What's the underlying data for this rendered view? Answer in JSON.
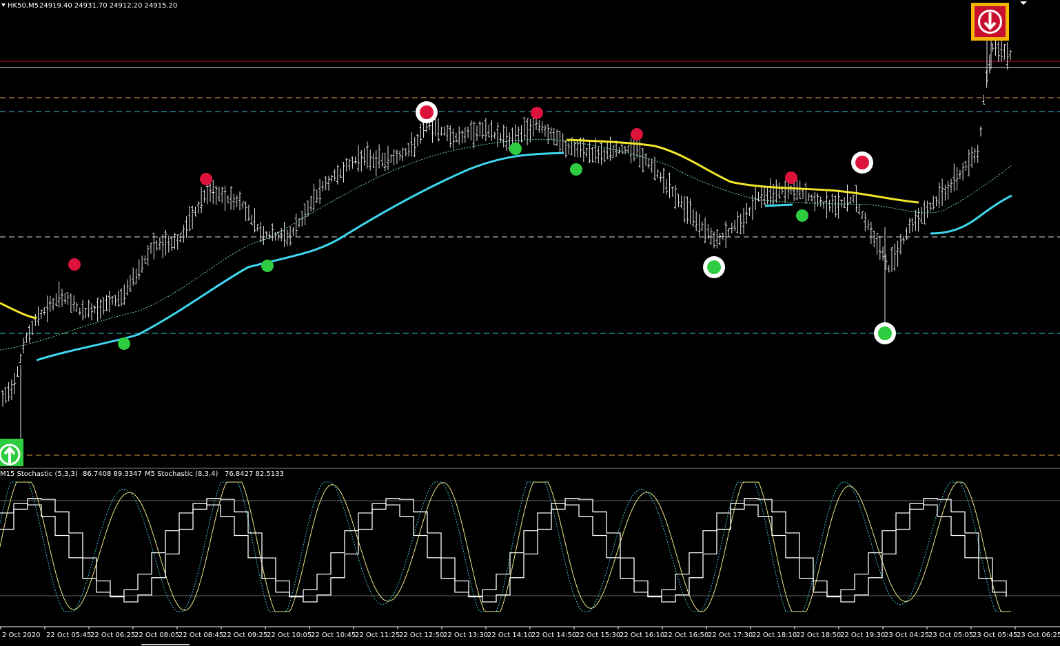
{
  "main_header": {
    "symbol": "HK50,M5",
    "ohlc": "24919.40 24931.70 24912.20 24915.20"
  },
  "indicator_header": {
    "stoch1_label": "M15 Stochastic (5,3,3)",
    "stoch1_values": "86.7408 89.3347",
    "stoch2_label": "M5 Stochastic (8,3,4)",
    "stoch2_values": "76.8427 82.5133"
  },
  "time_axis": {
    "labels": [
      "2 Oct 2020",
      "22 Oct 05:45",
      "22 Oct 06:25",
      "22 Oct 08:05",
      "22 Oct 08:45",
      "22 Oct 09:25",
      "22 Oct 10:05",
      "22 Oct 10:45",
      "22 Oct 11:25",
      "22 Oct 12:50",
      "22 Oct 13:30",
      "22 Oct 14:10",
      "22 Oct 14:50",
      "22 Oct 15:30",
      "22 Oct 16:10",
      "22 Oct 16:50",
      "22 Oct 17:30",
      "22 Oct 18:10",
      "22 Oct 18:50",
      "22 Oct 19:30",
      "23 Oct 04:25",
      "23 Oct 05:05",
      "23 Oct 05:45",
      "23 Oct 06:25"
    ]
  },
  "colors": {
    "background": "#000000",
    "buy_signal": "#2ecc40",
    "sell_signal": "#dc143c",
    "ma_fast": "#3fd8f0",
    "ma_slow": "#f2e52a",
    "resistance": "#c8102e",
    "level_orange": "#d9a441",
    "level_teal": "#3cc8d8",
    "arrow_frame": "#f5b400"
  },
  "signals": {
    "sell_count": 6,
    "buy_count": 6,
    "strong_sell_count": 3,
    "strong_buy_count": 2
  }
}
